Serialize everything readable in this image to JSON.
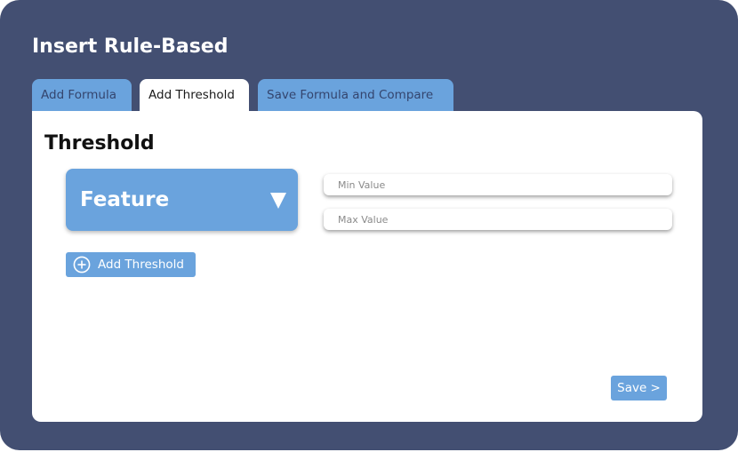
{
  "app": {
    "title": "Insert Rule-Based"
  },
  "tabs": [
    {
      "label": "Add Formula",
      "active": false
    },
    {
      "label": "Add Threshold",
      "active": true
    },
    {
      "label": "Save Formula and Compare",
      "active": false
    }
  ],
  "threshold": {
    "heading": "Threshold",
    "feature_select_label": "Feature",
    "feature_select_icon": "caret-down-icon",
    "min_field": {
      "placeholder": "Min Value",
      "value": ""
    },
    "max_field": {
      "placeholder": "Max Value",
      "value": ""
    },
    "add_button": {
      "label": "Add Threshold",
      "icon": "plus-circle-icon"
    }
  },
  "footer": {
    "save_label": "Save >"
  },
  "colors": {
    "background": "#434f72",
    "accent": "#6aa3dd",
    "card": "#ffffff",
    "inactive_tab_text": "#34456e"
  }
}
